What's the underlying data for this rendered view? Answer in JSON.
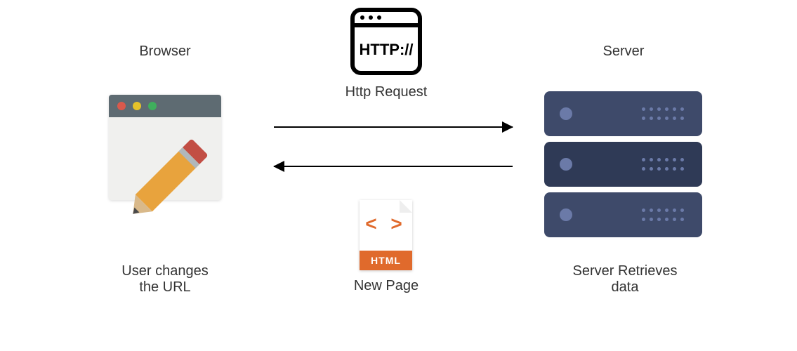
{
  "diagram": {
    "browser": {
      "title": "Browser",
      "caption_line1": "User changes",
      "caption_line2": "the URL"
    },
    "http": {
      "protocol_text": "HTTP://",
      "label": "Http Request"
    },
    "html_file": {
      "code_symbols": "< >",
      "band_text": "HTML",
      "label": "New Page"
    },
    "server": {
      "title": "Server",
      "caption_line1": "Server Retrieves",
      "caption_line2": "data"
    }
  }
}
